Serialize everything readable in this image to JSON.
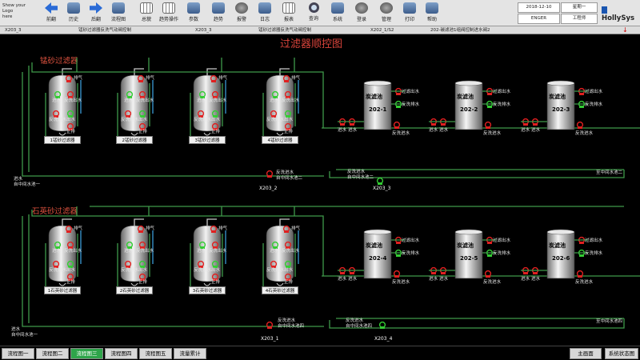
{
  "logo": {
    "line1": "Show your",
    "line2": "Logo",
    "line3": "here"
  },
  "toolbar": {
    "buttons": [
      {
        "label": "前翻",
        "icon": "back-arrow-icon"
      },
      {
        "label": "历史",
        "icon": "history-icon"
      },
      {
        "label": "后翻",
        "icon": "forward-arrow-icon"
      },
      {
        "label": "流程图",
        "icon": "flowchart-icon"
      },
      {
        "label": "总貌",
        "icon": "overview-icon"
      },
      {
        "label": "趋势操作",
        "icon": "trend-op-icon"
      },
      {
        "label": "参数",
        "icon": "parameter-icon"
      },
      {
        "label": "趋势",
        "icon": "trend-icon"
      },
      {
        "label": "报警",
        "icon": "alarm-icon"
      },
      {
        "label": "日志",
        "icon": "log-icon"
      },
      {
        "label": "报表",
        "icon": "report-icon"
      },
      {
        "label": "查询",
        "icon": "query-icon"
      },
      {
        "label": "系统",
        "icon": "system-icon"
      },
      {
        "label": "登录",
        "icon": "login-icon"
      },
      {
        "label": "管理",
        "icon": "manage-icon"
      },
      {
        "label": "打印",
        "icon": "print-icon"
      },
      {
        "label": "帮助",
        "icon": "help-icon"
      }
    ],
    "datetime": "2018-12-10 15:07:48",
    "weekday": "星期一",
    "user": "ENGER",
    "role": "工程师",
    "brand": "HollySys"
  },
  "pathbar": {
    "items": [
      "X203_3",
      "锰砂过滤器反洗气动阀控制",
      "X203_3",
      "锰砂过滤器反洗气动阀控制",
      "X202_1/S2",
      "202-碳滤池1组阀控制进水阀2"
    ]
  },
  "title": "过滤器顺控图",
  "sections": {
    "mn": "锰砂过滤器",
    "qz": "石英砂过滤器"
  },
  "mn_filters": [
    "1锰砂过滤器",
    "2锰砂过滤器",
    "3锰砂过滤器",
    "4锰砂过滤器"
  ],
  "qz_filters": [
    "1石英砂过滤器",
    "2石英砂过滤器",
    "3石英砂过滤器",
    "4石英砂过滤器"
  ],
  "carbon_top": [
    "202-1",
    "202-2",
    "202-3"
  ],
  "carbon_bottom": [
    "202-4",
    "202-5",
    "202-6"
  ],
  "carbon_name": "炭滤池",
  "valves": {
    "paiqi": "排气",
    "fanxi_chushui": "反洗出水",
    "jinshui": "进水",
    "fanxi_jinshui": "反洗进水",
    "chushui": "出水",
    "zhengpai": "正排",
    "guolv_chushui": "过滤出水",
    "fanxi_paishui": "反洗排水"
  },
  "notes": {
    "inlet_mn": "进水\n自中间水池一",
    "backwash_mn": "反洗进水\n自中间水池二",
    "backwash_c1": "反洗进水\n自中间水池二",
    "out_top": "至中间水池二",
    "inlet_qz": "进水\n自中间水池一",
    "backwash_qz": "反洗进水\n自中间水池四",
    "backwash_c2": "反洗进水\n自中间水池四",
    "out_bottom": "至中间水池四"
  },
  "tags": {
    "t1": "X203_2",
    "t2": "X203_3",
    "t3": "X203_1",
    "t4": "X203_4"
  },
  "bottom_tabs": [
    "流程图一",
    "流程图二",
    "流程图三",
    "流程图四",
    "流程图五",
    "流量累计"
  ],
  "active_tab": 2,
  "right_tabs": [
    "主画面",
    "系统状态图"
  ],
  "colors": {
    "pipe": "#3f9a4a",
    "valve_closed": "#e02020",
    "valve_open": "#33cc33",
    "tank": "#c8c8c8",
    "title": "#d9443b"
  }
}
